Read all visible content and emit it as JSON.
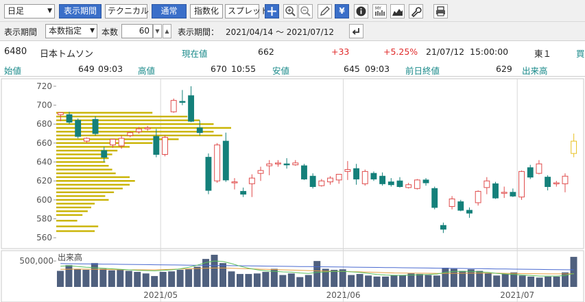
{
  "toolbar": {
    "period_select": "日足",
    "period_button": "表示期間",
    "technical_button": "テクニカル",
    "normal_button": "通常",
    "index_button": "指数化",
    "spread_button": "スプレッド",
    "icons": [
      "plus-icon",
      "zoom-in-icon",
      "zoom-out-icon",
      "pencil-icon",
      "yen-icon",
      "info-icon",
      "my-chart-icon",
      "area-chart-icon",
      "wrench-icon",
      "print-icon"
    ]
  },
  "range": {
    "label": "表示期間",
    "mode_select": "本数指定",
    "count_label": "本数",
    "count_value": "60",
    "period_label": "表示期間：",
    "period_value": "2021/04/14 ～ 2021/07/12"
  },
  "stock": {
    "code": "6480",
    "name": "日本トムソン",
    "current_label": "現在値",
    "current_value": "662",
    "change": "+33",
    "change_pct": "+5.25%",
    "date": "21/07/12",
    "time": "15:00:00",
    "market": "東１",
    "buy_label": "買",
    "open_label": "始値",
    "open_value": "649",
    "open_time": "09:03",
    "high_label": "高値",
    "high_value": "670",
    "high_time": "10:55",
    "low_label": "安値",
    "low_value": "645",
    "low_time": "09:03",
    "prev_label": "前日終値",
    "prev_value": "629",
    "volume_label": "出来高"
  },
  "colors": {
    "up": "#e04b4b",
    "down": "#14807a",
    "latest": "#e8c020",
    "volume_bar": "#4f607e",
    "profile": "#c9b300",
    "ma_green": "#5cc05c",
    "ma_orange": "#e8a040",
    "ma_blue": "#4a6ad0"
  },
  "chart_data": {
    "type": "candlestick",
    "ylim": [
      550,
      725
    ],
    "y_ticks": [
      560,
      580,
      600,
      620,
      640,
      660,
      680,
      700,
      720
    ],
    "x_labels": [
      "2021/05",
      "2021/06",
      "2021/07"
    ],
    "volume_label": "出来高",
    "volume_tick": "500,000",
    "candles": [
      [
        690,
        692,
        683,
        692
      ],
      [
        690,
        693,
        680,
        682
      ],
      [
        684,
        686,
        665,
        667
      ],
      [
        662,
        666,
        660,
        665
      ],
      [
        685,
        688,
        668,
        670
      ],
      [
        652,
        656,
        640,
        645
      ],
      [
        658,
        664,
        655,
        664
      ],
      [
        657,
        668,
        654,
        665
      ],
      [
        668,
        672,
        666,
        671
      ],
      [
        672,
        677,
        670,
        675
      ],
      [
        675,
        678,
        673,
        676
      ],
      [
        667,
        675,
        645,
        648
      ],
      [
        648,
        668,
        646,
        666
      ],
      [
        693,
        707,
        692,
        705
      ],
      [
        704,
        716,
        700,
        703
      ],
      [
        710,
        720,
        682,
        683
      ],
      [
        676,
        684,
        668,
        671
      ],
      [
        645,
        649,
        606,
        610
      ],
      [
        620,
        660,
        618,
        658
      ],
      [
        662,
        671,
        619,
        621
      ],
      [
        619,
        623,
        611,
        619
      ],
      [
        609,
        613,
        603,
        606
      ],
      [
        617,
        627,
        603,
        623
      ],
      [
        628,
        635,
        620,
        631
      ],
      [
        636,
        642,
        626,
        638
      ],
      [
        639,
        642,
        635,
        639
      ],
      [
        638,
        644,
        633,
        637
      ],
      [
        637,
        642,
        636,
        639
      ],
      [
        636,
        638,
        621,
        622
      ],
      [
        625,
        628,
        612,
        614
      ],
      [
        615,
        622,
        614,
        620
      ],
      [
        619,
        625,
        616,
        623
      ],
      [
        621,
        627,
        617,
        627
      ],
      [
        630,
        641,
        621,
        632
      ],
      [
        633,
        638,
        616,
        622
      ],
      [
        617,
        632,
        615,
        630
      ],
      [
        628,
        630,
        620,
        622
      ],
      [
        625,
        629,
        615,
        617
      ],
      [
        619,
        623,
        614,
        616
      ],
      [
        620,
        624,
        613,
        614
      ],
      [
        613,
        618,
        612,
        616
      ],
      [
        612,
        622,
        611,
        621
      ],
      [
        621,
        623,
        615,
        618
      ],
      [
        612,
        614,
        590,
        592
      ],
      [
        573,
        576,
        565,
        569
      ],
      [
        593,
        604,
        590,
        601
      ],
      [
        598,
        600,
        588,
        589
      ],
      [
        589,
        592,
        581,
        586
      ],
      [
        597,
        610,
        594,
        609
      ],
      [
        613,
        624,
        606,
        620
      ],
      [
        617,
        619,
        601,
        602
      ],
      [
        608,
        614,
        602,
        608
      ],
      [
        608,
        612,
        603,
        604
      ],
      [
        603,
        631,
        600,
        630
      ],
      [
        634,
        637,
        622,
        624
      ],
      [
        628,
        642,
        627,
        638
      ],
      [
        624,
        626,
        610,
        614
      ],
      [
        617,
        620,
        614,
        618
      ],
      [
        617,
        628,
        608,
        625
      ],
      [
        649,
        670,
        645,
        662
      ]
    ],
    "volume": [
      310,
      420,
      340,
      330,
      460,
      350,
      320,
      330,
      310,
      290,
      260,
      210,
      290,
      300,
      330,
      340,
      390,
      540,
      620,
      460,
      300,
      250,
      250,
      260,
      290,
      350,
      230,
      260,
      190,
      230,
      500,
      350,
      330,
      340,
      230,
      250,
      220,
      200,
      200,
      230,
      230,
      260,
      250,
      230,
      220,
      370,
      350,
      310,
      340,
      310,
      270,
      220,
      250,
      280,
      220,
      200,
      180,
      200,
      200,
      280,
      580
    ],
    "ma_lines": {
      "green": [
        400,
        410,
        395,
        380,
        370,
        360,
        350,
        340,
        330,
        320,
        315,
        310,
        320,
        330,
        350,
        380,
        420,
        470,
        500,
        490,
        450,
        400,
        360,
        330,
        310,
        300,
        290,
        285,
        270,
        260,
        280,
        290,
        300,
        300,
        290,
        280,
        260,
        240,
        230,
        225,
        225,
        230,
        235,
        240,
        250,
        280,
        300,
        300,
        300,
        290,
        280,
        260,
        250,
        240,
        230,
        220,
        210,
        210,
        210,
        220,
        260
      ],
      "orange": [
        340,
        342,
        345,
        343,
        340,
        338,
        335,
        332,
        330,
        330,
        330,
        330,
        335,
        340,
        345,
        350,
        355,
        360,
        365,
        365,
        360,
        355,
        350,
        345,
        340,
        335,
        330,
        325,
        320,
        315,
        310,
        305,
        300,
        300,
        295,
        290,
        285,
        280,
        275,
        270,
        268,
        266,
        265,
        264,
        262,
        262,
        263,
        264,
        265,
        266,
        266,
        265,
        263,
        260,
        258,
        256,
        254,
        252,
        252,
        252,
        255
      ],
      "blue": [
        450,
        448,
        446,
        444,
        442,
        440,
        438,
        436,
        434,
        432,
        430,
        428,
        426,
        424,
        422,
        420,
        418,
        416,
        414,
        412,
        410,
        408,
        406,
        404,
        402,
        400,
        398,
        396,
        394,
        392,
        390,
        388,
        386,
        384,
        382,
        380,
        378,
        376,
        374,
        372,
        370,
        368,
        366,
        364,
        362,
        360,
        358,
        356,
        354,
        352,
        350,
        348,
        346,
        344,
        342,
        340,
        338,
        336,
        334,
        332,
        330
      ]
    },
    "volume_profile": [
      {
        "price": 692,
        "amount": 0.55
      },
      {
        "price": 688,
        "amount": 0.75
      },
      {
        "price": 684,
        "amount": 0.82
      },
      {
        "price": 680,
        "amount": 0.9
      },
      {
        "price": 676,
        "amount": 1.0
      },
      {
        "price": 672,
        "amount": 0.9
      },
      {
        "price": 668,
        "amount": 0.95
      },
      {
        "price": 664,
        "amount": 0.7
      },
      {
        "price": 660,
        "amount": 0.55
      },
      {
        "price": 656,
        "amount": 0.42
      },
      {
        "price": 652,
        "amount": 0.35
      },
      {
        "price": 648,
        "amount": 0.32
      },
      {
        "price": 644,
        "amount": 0.3
      },
      {
        "price": 640,
        "amount": 0.28
      },
      {
        "price": 636,
        "amount": 0.3
      },
      {
        "price": 632,
        "amount": 0.32
      },
      {
        "price": 628,
        "amount": 0.34
      },
      {
        "price": 624,
        "amount": 0.42
      },
      {
        "price": 620,
        "amount": 0.45
      },
      {
        "price": 616,
        "amount": 0.42
      },
      {
        "price": 612,
        "amount": 0.38
      },
      {
        "price": 608,
        "amount": 0.33
      },
      {
        "price": 604,
        "amount": 0.28
      },
      {
        "price": 600,
        "amount": 0.3
      },
      {
        "price": 596,
        "amount": 0.22
      },
      {
        "price": 592,
        "amount": 0.2
      },
      {
        "price": 588,
        "amount": 0.18
      },
      {
        "price": 584,
        "amount": 0.15
      },
      {
        "price": 578,
        "amount": 0.12
      },
      {
        "price": 572,
        "amount": 0.24
      },
      {
        "price": 567,
        "amount": 0.22
      }
    ]
  }
}
